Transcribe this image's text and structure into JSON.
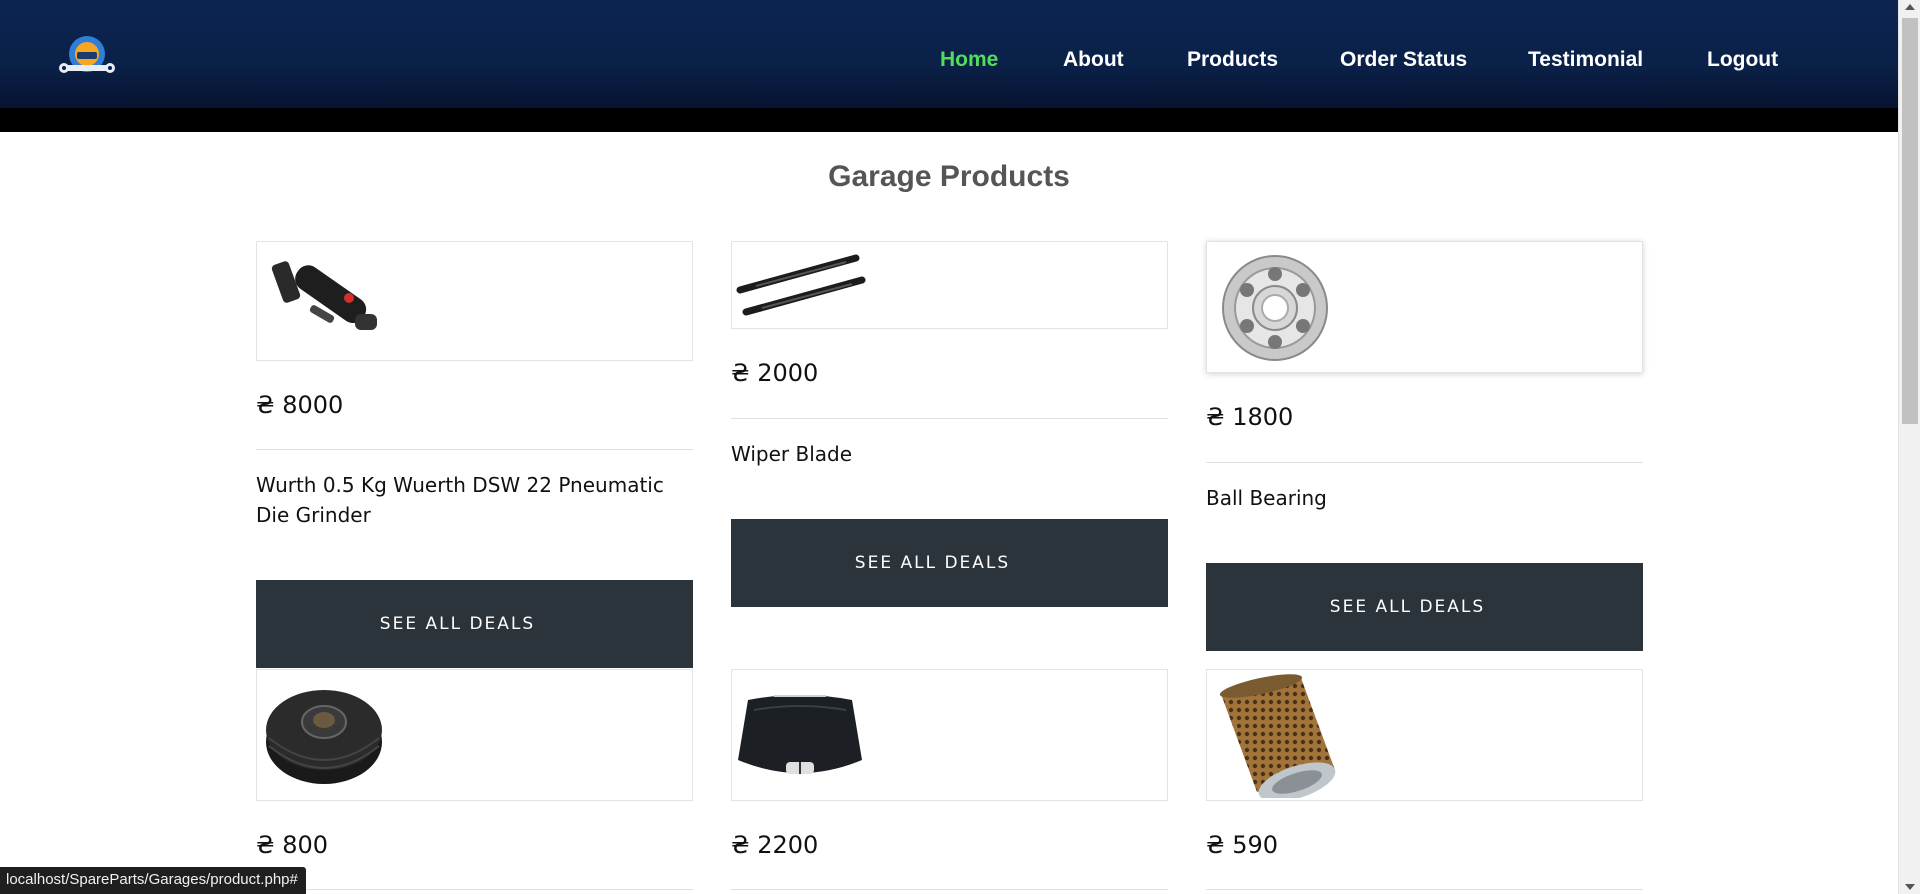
{
  "header": {
    "logo_icon": "car-wrench-logo-icon",
    "nav": [
      {
        "label": "Home",
        "active": true
      },
      {
        "label": "About",
        "active": false
      },
      {
        "label": "Products",
        "active": false
      },
      {
        "label": "Order Status",
        "active": false
      },
      {
        "label": "Testimonial",
        "active": false
      },
      {
        "label": "Logout",
        "active": false
      }
    ],
    "active_color": "#4fdd5a"
  },
  "main": {
    "title": "Garage Products",
    "products": [
      {
        "image": "die-grinder-icon",
        "price": "₴ 8000",
        "name": "Wurth 0.5 Kg Wuerth DSW 22 Pneumatic Die Grinder",
        "button": "SEE ALL DEALS"
      },
      {
        "image": "wiper-blade-icon",
        "price": "₴ 2000",
        "name": "Wiper Blade",
        "button": "SEE ALL DEALS"
      },
      {
        "image": "ball-bearing-icon",
        "price": "₴ 1800",
        "name": "Ball Bearing",
        "button": "SEE ALL DEALS"
      },
      {
        "image": "pulley-icon",
        "price": "₴ 800"
      },
      {
        "image": "car-hood-icon",
        "price": "₴ 2200"
      },
      {
        "image": "air-filter-icon",
        "price": "₴ 590"
      }
    ]
  },
  "statusbar": {
    "url": "localhost/SpareParts/Garages/product.php#"
  },
  "colors": {
    "header_bg": "#0a2148",
    "button_bg": "#2c343b"
  }
}
